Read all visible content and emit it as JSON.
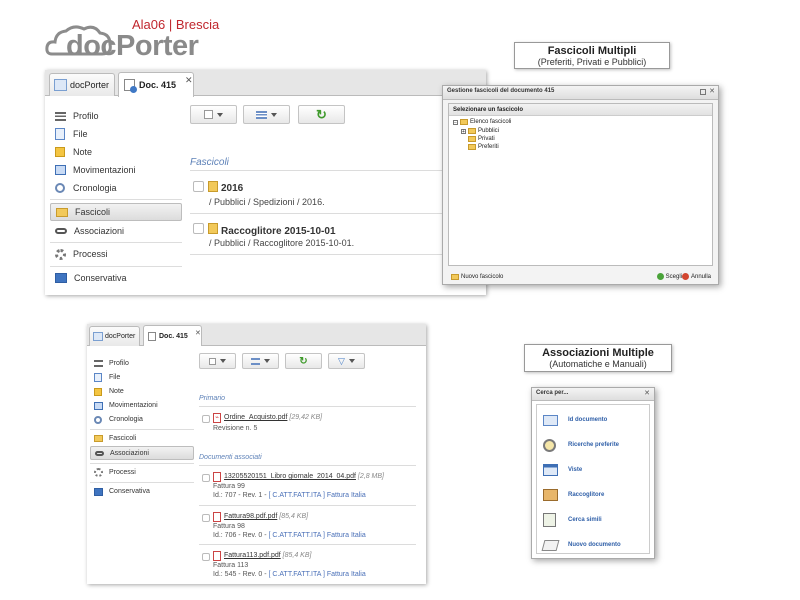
{
  "brand": {
    "logo_text": "docPorter",
    "tagline": "Ala06 | Brescia"
  },
  "top": {
    "tabs": [
      {
        "label": "docPorter"
      },
      {
        "label": "Doc. 415"
      }
    ],
    "sidebar": [
      {
        "label": "Profilo"
      },
      {
        "label": "File"
      },
      {
        "label": "Note"
      },
      {
        "label": "Movimentazioni"
      },
      {
        "label": "Cronologia"
      },
      {
        "label": "Fascicoli"
      },
      {
        "label": "Associazioni"
      },
      {
        "label": "Processi"
      },
      {
        "label": "Conservativa"
      }
    ],
    "section": "Fascicoli",
    "items": [
      {
        "title": "2016",
        "path": "/ Pubblici / Spedizioni / 2016."
      },
      {
        "title": "Raccoglitore 2015-10-01",
        "path": "/ Pubblici / Raccoglitore 2015-10-01."
      }
    ]
  },
  "caption1": {
    "title": "Fascicoli Multipli",
    "subtitle": "(Preferiti, Privati e Pubblici)"
  },
  "dialog": {
    "title": "Gestione fascicoli del documento 415",
    "header": "Selezionare un fascicolo",
    "tree": {
      "root": "Elenco fascicoli",
      "children": [
        "Pubblici",
        "Privati",
        "Preferiti"
      ]
    },
    "new_label": "Nuovo fascicolo",
    "choose_label": "Scegli",
    "cancel_label": "Annulla"
  },
  "bottom": {
    "tabs": [
      {
        "label": "docPorter"
      },
      {
        "label": "Doc. 415"
      }
    ],
    "sidebar": [
      {
        "label": "Profilo"
      },
      {
        "label": "File"
      },
      {
        "label": "Note"
      },
      {
        "label": "Movimentazioni"
      },
      {
        "label": "Cronologia"
      },
      {
        "label": "Fascicoli"
      },
      {
        "label": "Associazioni"
      },
      {
        "label": "Processi"
      },
      {
        "label": "Conservativa"
      }
    ],
    "primary_section": "Primario",
    "primary": {
      "file": "Ordine_Acquisto.pdf",
      "size": "[29,42 KB]",
      "revision": "Revisione n. 5"
    },
    "assoc_section": "Documenti associati",
    "docs": [
      {
        "file": "13205520151_Libro giornale_2014_04.pdf",
        "size": "[2,8 MB]",
        "name": "Fattura 99",
        "meta": "Id.: 707 - Rev. 1 - ",
        "links": "[ C.ATT.FATT.ITA ] Fattura Italia"
      },
      {
        "file": "Fattura98.pdf.pdf",
        "size": "[85,4 KB]",
        "name": "Fattura 98",
        "meta": "Id.: 706 - Rev. 0 - ",
        "links": "[ C.ATT.FATT.ITA ] Fattura Italia"
      },
      {
        "file": "Fattura113.pdf.pdf",
        "size": "[85,4 KB]",
        "name": "Fattura 113",
        "meta": "Id.: 545 - Rev. 0 - ",
        "links": "[ C.ATT.FATT.ITA ] Fattura Italia"
      }
    ]
  },
  "caption2": {
    "title": "Associazioni Multiple",
    "subtitle": "(Automatiche e Manuali)"
  },
  "cerca": {
    "title": "Cerca per...",
    "items": [
      {
        "label": "Id documento"
      },
      {
        "label": "Ricerche preferite"
      },
      {
        "label": "Viste"
      },
      {
        "label": "Raccoglitore"
      },
      {
        "label": "Cerca simili"
      },
      {
        "label": "Nuovo documento"
      }
    ]
  }
}
